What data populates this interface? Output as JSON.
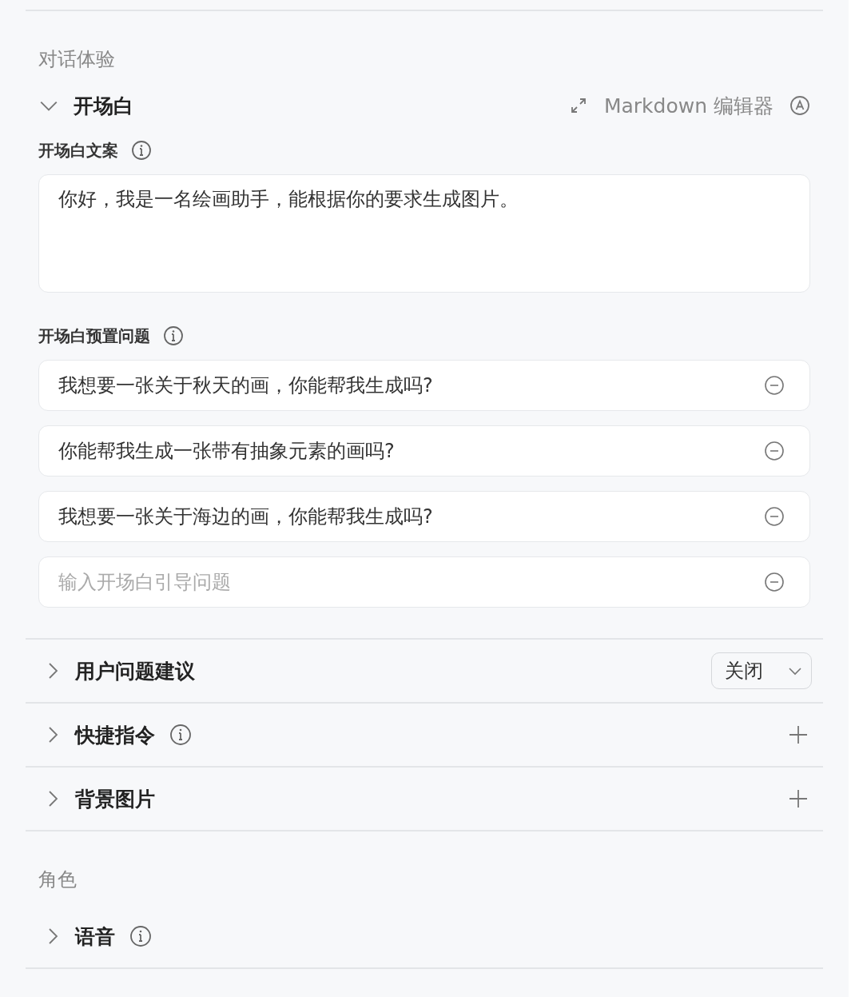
{
  "sections": [
    {
      "heading": "对话体验",
      "opening": {
        "title": "开场白",
        "expanded": true,
        "editor_label": "Markdown 编辑器",
        "copy_label": "开场白文案",
        "copy_text": "你好，我是一名绘画助手，能根据你的要求生成图片。",
        "questions_label": "开场白预置问题",
        "questions": [
          {
            "value": "我想要一张关于秋天的画，你能帮我生成吗?"
          },
          {
            "value": "你能帮我生成一张带有抽象元素的画吗?"
          },
          {
            "value": "我想要一张关于海边的画，你能帮我生成吗?"
          },
          {
            "placeholder": "输入开场白引导问题"
          }
        ]
      },
      "rows": [
        {
          "title": "用户问题建议",
          "expanded": false,
          "info": false,
          "kind": "select",
          "value": "关闭"
        },
        {
          "title": "快捷指令",
          "expanded": false,
          "info": true,
          "kind": "add"
        },
        {
          "title": "背景图片",
          "expanded": false,
          "info": false,
          "kind": "add"
        }
      ]
    },
    {
      "heading": "角色",
      "rows": [
        {
          "title": "语音",
          "expanded": false,
          "info": true,
          "kind": "none"
        }
      ]
    }
  ]
}
